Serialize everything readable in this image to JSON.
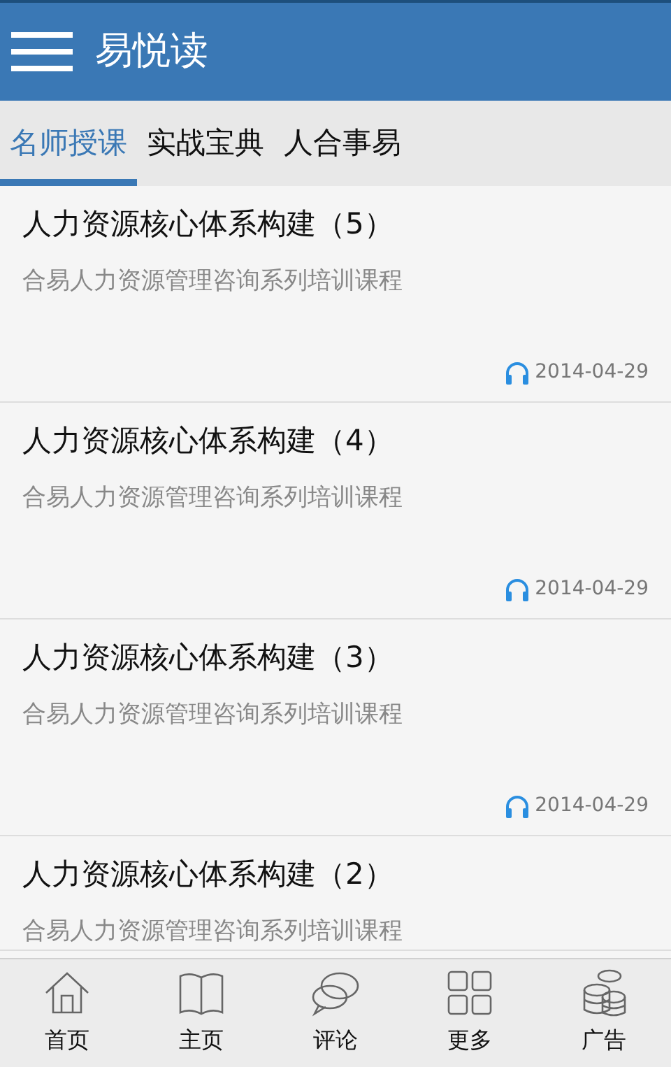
{
  "app_bar": {
    "title": "易悦读"
  },
  "tabs": [
    {
      "label": "名师授课",
      "selected": true
    },
    {
      "label": "实战宝典",
      "selected": false
    },
    {
      "label": "人合事易",
      "selected": false
    }
  ],
  "courses": [
    {
      "title": "人力资源核心体系构建（5）",
      "subtitle": "合易人力资源管理咨询系列培训课程",
      "date": "2014-04-29"
    },
    {
      "title": "人力资源核心体系构建（4）",
      "subtitle": "合易人力资源管理咨询系列培训课程",
      "date": "2014-04-29"
    },
    {
      "title": "人力资源核心体系构建（3）",
      "subtitle": "合易人力资源管理咨询系列培训课程",
      "date": "2014-04-29"
    },
    {
      "title": "人力资源核心体系构建（2）",
      "subtitle": "合易人力资源管理咨询系列培训课程"
    }
  ],
  "bottom_nav": [
    {
      "kind": "home",
      "label": "首页"
    },
    {
      "kind": "book",
      "label": "主页"
    },
    {
      "kind": "comment",
      "label": "评论"
    },
    {
      "kind": "grid",
      "label": "更多"
    },
    {
      "kind": "coins",
      "label": "广告"
    }
  ]
}
